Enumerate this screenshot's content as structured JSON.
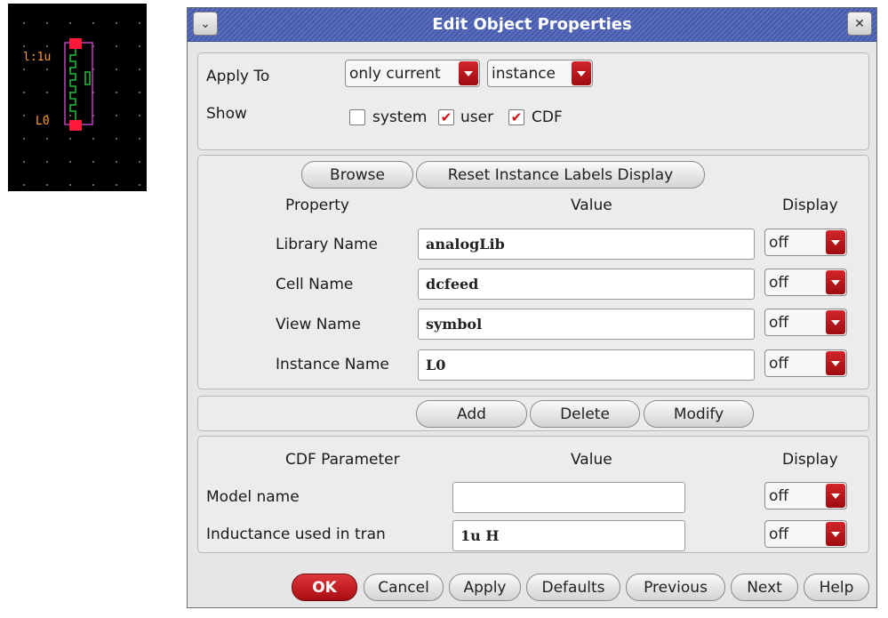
{
  "schematic": {
    "inductance_label": "l:1u",
    "instance_label": "L0"
  },
  "dialog": {
    "title": "Edit Object Properties",
    "apply_to": {
      "label": "Apply To",
      "scope": "only current",
      "type": "instance"
    },
    "show": {
      "label": "Show",
      "options": [
        {
          "label": "system",
          "checked": false
        },
        {
          "label": "user",
          "checked": true
        },
        {
          "label": "CDF",
          "checked": true
        }
      ]
    },
    "top_buttons": {
      "browse": "Browse",
      "reset": "Reset Instance Labels Display"
    },
    "property_headers": {
      "property": "Property",
      "value": "Value",
      "display": "Display"
    },
    "properties": [
      {
        "name": "Library Name",
        "value": "analogLib",
        "display": "off"
      },
      {
        "name": "Cell Name",
        "value": "dcfeed",
        "display": "off"
      },
      {
        "name": "View Name",
        "value": "symbol",
        "display": "off"
      },
      {
        "name": "Instance Name",
        "value": "L0",
        "display": "off"
      }
    ],
    "edit_buttons": {
      "add": "Add",
      "delete": "Delete",
      "modify": "Modify"
    },
    "cdf_headers": {
      "parameter": "CDF Parameter",
      "value": "Value",
      "display": "Display"
    },
    "cdf_parameters": [
      {
        "name": "Model name",
        "value": "",
        "display": "off"
      },
      {
        "name": "Inductance used in tran",
        "value": "1u H",
        "display": "off"
      }
    ],
    "footer_buttons": {
      "ok": "OK",
      "cancel": "Cancel",
      "apply": "Apply",
      "defaults": "Defaults",
      "previous": "Previous",
      "next": "Next",
      "help": "Help"
    }
  }
}
